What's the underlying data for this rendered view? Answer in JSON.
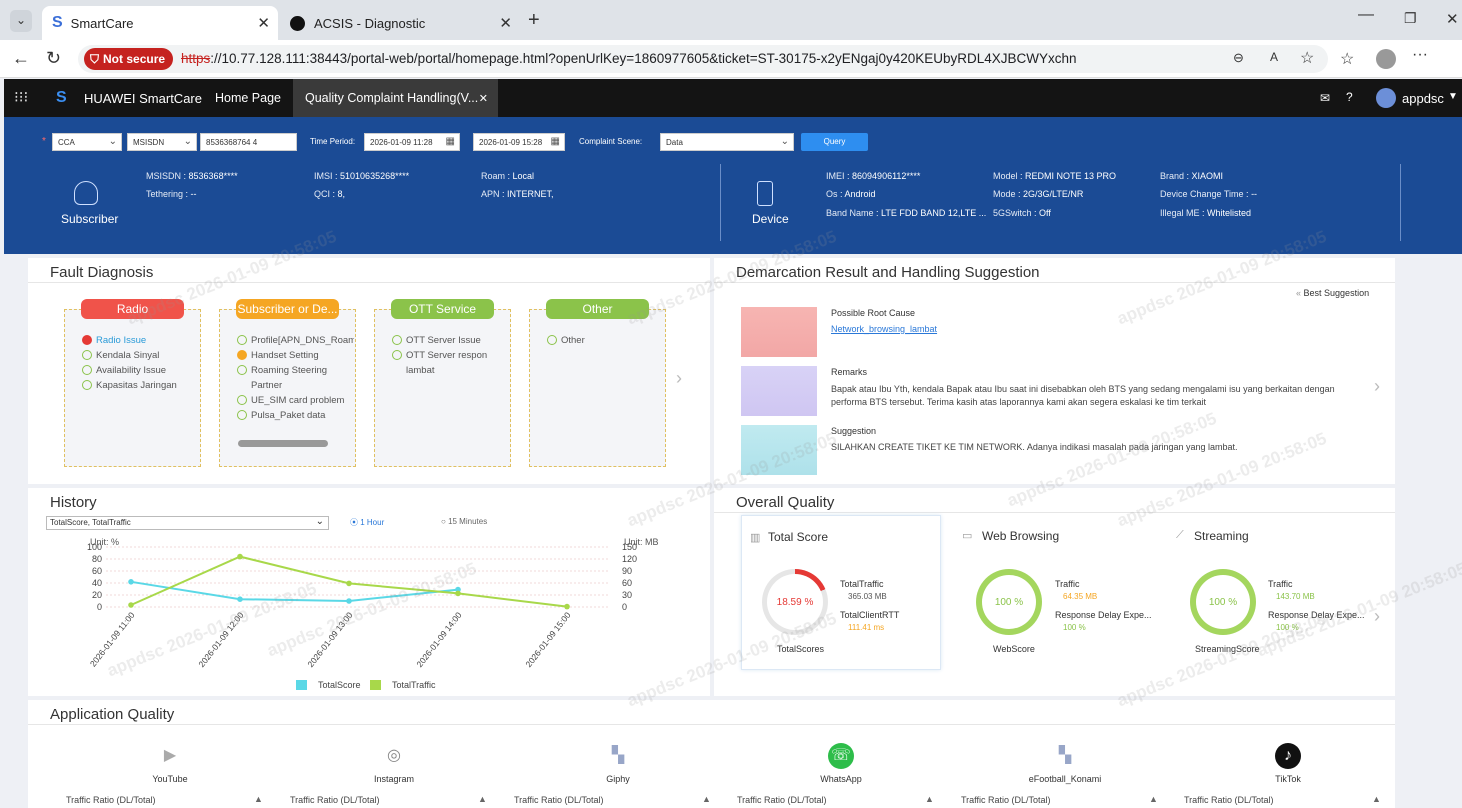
{
  "browser": {
    "tabs": [
      {
        "title": "SmartCare"
      },
      {
        "title": "ACSIS - Diagnostic"
      }
    ],
    "security_label": "Not secure",
    "url_scheme": "https",
    "url_rest": "://10.77.128.111:38443/portal-web/portal/homepage.html?openUrlKey=1860977605&ticket=ST-30175-x2yENgaj0y420KEUbyRDL4XJBCWYxchn"
  },
  "app": {
    "brand": "HUAWEI SmartCare",
    "tabs": [
      {
        "label": "Home Page"
      },
      {
        "label": "Quality Complaint Handling(V..."
      }
    ],
    "user": "appdsc"
  },
  "query": {
    "type": "CCA",
    "id_type": "MSISDN",
    "id_value": "8536368764 4",
    "time_label": "Time Period:",
    "start": "2026-01-09 11:28",
    "end": "2026-01-09 15:28",
    "scene_label": "Complaint Scene:",
    "scene": "Data",
    "query_btn": "Query"
  },
  "subscriber": {
    "label": "Subscriber",
    "fields": [
      {
        "k": "MSISDN",
        "v": "8536368****"
      },
      {
        "k": "Tethering",
        "v": "--"
      },
      {
        "k": "IMSI",
        "v": "51010635268****"
      },
      {
        "k": "QCI",
        "v": "8,"
      },
      {
        "k": "Roam",
        "v": "Local"
      },
      {
        "k": "APN",
        "v": "INTERNET,"
      }
    ]
  },
  "device": {
    "label": "Device",
    "fields": [
      {
        "k": "IMEI",
        "v": "86094906112****"
      },
      {
        "k": "Os",
        "v": "Android"
      },
      {
        "k": "Band Name",
        "v": "LTE FDD BAND 12,LTE ..."
      },
      {
        "k": "Model",
        "v": "REDMI NOTE 13 PRO"
      },
      {
        "k": "Mode",
        "v": "2G/3G/LTE/NR"
      },
      {
        "k": "5GSwitch",
        "v": "Off"
      },
      {
        "k": "Brand",
        "v": "XIAOMI"
      },
      {
        "k": "Device Change Time",
        "v": "--"
      },
      {
        "k": "Illegal ME",
        "v": "Whitelisted"
      }
    ]
  },
  "fault": {
    "title": "Fault Diagnosis",
    "groups": [
      {
        "name": "Radio",
        "color": "#f0534a",
        "items": [
          {
            "text": "Radio Issue",
            "status": "error"
          },
          {
            "text": "Kendala Sinyal",
            "status": "ok"
          },
          {
            "text": "Availability Issue",
            "status": "ok"
          },
          {
            "text": "Kapasitas Jaringan",
            "status": "ok"
          }
        ]
      },
      {
        "name": "Subscriber or De...",
        "color": "#f5a623",
        "items": [
          {
            "text": "Profile[APN_DNS_Roam",
            "status": "ok"
          },
          {
            "text": "Handset Setting",
            "status": "warn"
          },
          {
            "text": "Roaming Steering Partner",
            "status": "ok"
          },
          {
            "text": "UE_SIM card problem",
            "status": "ok"
          },
          {
            "text": "Pulsa_Paket data",
            "status": "ok"
          }
        ]
      },
      {
        "name": "OTT Service",
        "color": "#8bc34a",
        "items": [
          {
            "text": "OTT Server Issue",
            "status": "ok"
          },
          {
            "text": "OTT Server respon lambat",
            "status": "ok"
          }
        ]
      },
      {
        "name": "Other",
        "color": "#8bc34a",
        "items": [
          {
            "text": "Other",
            "status": "ok"
          }
        ]
      }
    ]
  },
  "demarcation": {
    "title": "Demarcation Result and Handling Suggestion",
    "best": "Best Suggestion",
    "root_label": "Possible Root Cause",
    "root_value": "Network_browsing_lambat",
    "remarks_label": "Remarks",
    "remarks_text": "Bapak atau Ibu Yth, kendala Bapak atau Ibu saat ini disebabkan oleh BTS yang sedang mengalami isu yang berkaitan dengan performa BTS tersebut. Terima kasih atas laporannya kami akan segera eskalasi ke tim terkait",
    "suggestion_label": "Suggestion",
    "suggestion_text": "SILAHKAN CREATE TIKET KE TIM NETWORK. Adanya indikasi masalah pada jaringan yang lambat."
  },
  "history": {
    "title": "History",
    "selector": "TotalScore, TotalTraffic",
    "radio1": "1 Hour",
    "radio2": "15 Minutes"
  },
  "chart_data": {
    "type": "line",
    "x": [
      "2026-01-09 11:00",
      "2026-01-09 12:00",
      "2026-01-09 13:00",
      "2026-01-09 14:00",
      "2026-01-09 15:00"
    ],
    "series": [
      {
        "name": "TotalScore",
        "axis": "left",
        "color": "#5ad8e6",
        "values": [
          42,
          13,
          10,
          29,
          null
        ]
      },
      {
        "name": "TotalTraffic",
        "axis": "right",
        "color": "#a8d84a",
        "values": [
          5,
          126,
          59,
          34,
          1
        ]
      }
    ],
    "ylabel_left": "Unit: %",
    "ylabel_right": "Unit: MB",
    "yticks_left": [
      0,
      20,
      40,
      60,
      80,
      100
    ],
    "yticks_right": [
      0,
      30,
      60,
      90,
      120,
      150
    ],
    "ylim_left": [
      0,
      100
    ],
    "ylim_right": [
      0,
      150
    ],
    "legend_position": "bottom"
  },
  "overall": {
    "title": "Overall Quality",
    "total": {
      "title": "Total Score",
      "score": "18.59 %",
      "score_value": 18.59,
      "label": "TotalScores",
      "m1": "TotalTraffic",
      "v1": "365.03 MB",
      "m2": "TotalClientRTT",
      "v2": "111.41 ms"
    },
    "web": {
      "title": "Web Browsing",
      "score": "100 %",
      "score_value": 100,
      "label": "WebScore",
      "m1": "Traffic",
      "v1": "64.35 MB",
      "m2": "Response Delay Expe...",
      "v2": "100 %"
    },
    "stream": {
      "title": "Streaming",
      "score": "100 %",
      "score_value": 100,
      "label": "StreamingScore",
      "m1": "Traffic",
      "v1": "143.70 MB",
      "m2": "Response Delay Expe...",
      "v2": "100 %"
    }
  },
  "apps": {
    "title": "Application Quality",
    "items": [
      {
        "name": "YouTube",
        "icon": "youtube-icon"
      },
      {
        "name": "Instagram",
        "icon": "instagram-icon"
      },
      {
        "name": "Giphy",
        "icon": "app-grid-icon"
      },
      {
        "name": "WhatsApp",
        "icon": "whatsapp-icon"
      },
      {
        "name": "eFootball_Konami",
        "icon": "app-grid-icon"
      },
      {
        "name": "TikTok",
        "icon": "tiktok-icon"
      }
    ],
    "ratio_label": "Traffic Ratio (DL/Total)"
  },
  "watermark": "appdsc 2026-01-09 20:58:05"
}
